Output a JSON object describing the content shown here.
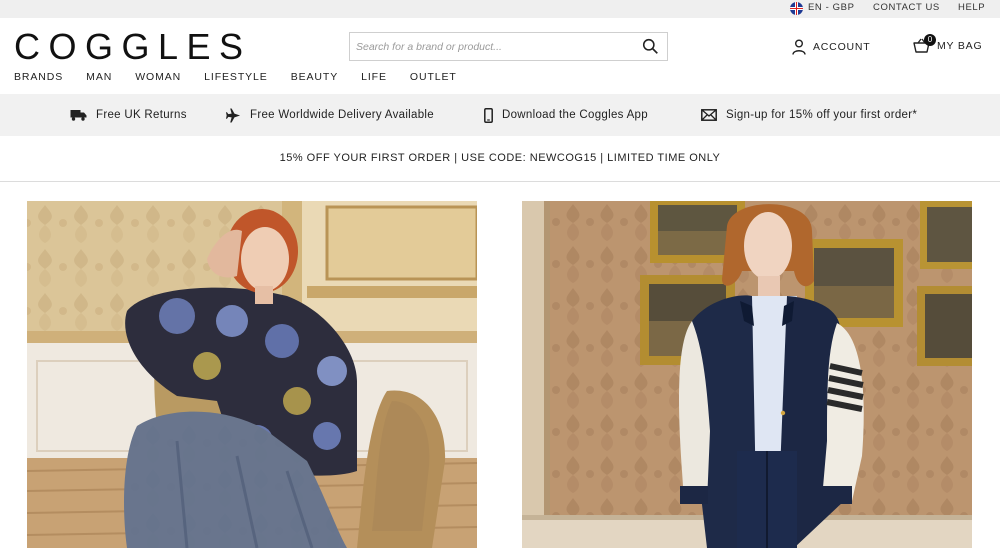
{
  "utility": {
    "locale": "EN - GBP",
    "contact": "CONTACT US",
    "help": "HELP"
  },
  "header": {
    "logo": "COGGLES",
    "search_placeholder": "Search for a brand or product...",
    "account_label": "ACCOUNT",
    "bag_label": "MY BAG",
    "bag_count": "0"
  },
  "nav": {
    "items": [
      "BRANDS",
      "MAN",
      "WOMAN",
      "LIFESTYLE",
      "BEAUTY",
      "LIFE",
      "OUTLET"
    ]
  },
  "benefits": {
    "returns": "Free UK Returns",
    "delivery": "Free Worldwide Delivery Available",
    "app": "Download the Coggles App",
    "signup": "Sign-up for 15% off your first order*"
  },
  "promo": {
    "text": "15% OFF YOUR FIRST ORDER | USE CODE: NEWCOG15 | LIMITED TIME ONLY"
  },
  "colors": {
    "utility_bg": "#efefef",
    "benefits_bg": "#f1f1f1",
    "text": "#222222"
  }
}
